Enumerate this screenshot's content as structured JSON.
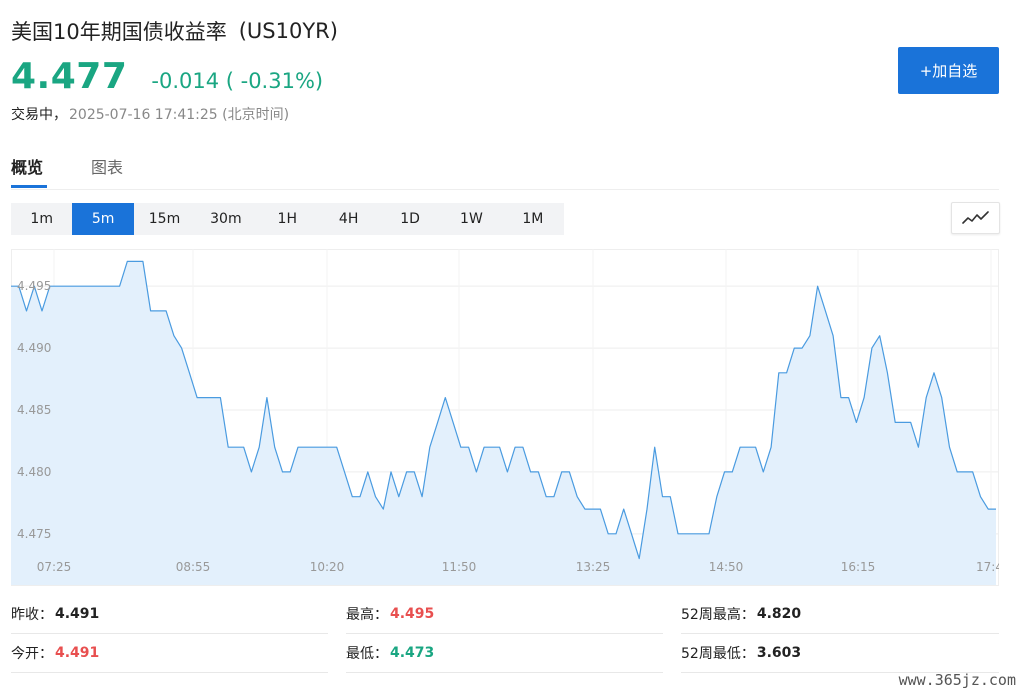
{
  "header": {
    "name": "美国10年期国债收益率",
    "code": "(US10YR)",
    "price": "4.477",
    "change": "-0.014 ( -0.31%)",
    "status_label": "交易中，",
    "status_time": "2025-07-16 17:41:25 (北京时间)",
    "add_button_label": "+加自选"
  },
  "tabs": [
    {
      "label": "概览",
      "active": true
    },
    {
      "label": "图表",
      "active": false
    }
  ],
  "periods": [
    {
      "label": "1m",
      "active": false
    },
    {
      "label": "5m",
      "active": true
    },
    {
      "label": "15m",
      "active": false
    },
    {
      "label": "30m",
      "active": false
    },
    {
      "label": "1H",
      "active": false
    },
    {
      "label": "4H",
      "active": false
    },
    {
      "label": "1D",
      "active": false
    },
    {
      "label": "1W",
      "active": false
    },
    {
      "label": "1M",
      "active": false
    }
  ],
  "chart_type_icon": "line-chart-icon",
  "colors": {
    "accent": "#1a73d9",
    "down": "#1aa682",
    "up": "#e84f4f",
    "line": "#4a9be0",
    "fill": "#e3f0fc"
  },
  "chart_data": {
    "type": "area",
    "title": "",
    "xlabel": "",
    "ylabel": "",
    "ylim": [
      4.472,
      4.498
    ],
    "yticks": [
      "4.475",
      "4.480",
      "4.485",
      "4.490",
      "4.495"
    ],
    "xtick_labels": [
      "07:25",
      "08:55",
      "10:20",
      "11:50",
      "13:25",
      "14:50",
      "16:15",
      "17:4"
    ],
    "grid": true,
    "values": [
      4.495,
      4.495,
      4.493,
      4.495,
      4.493,
      4.495,
      4.495,
      4.495,
      4.495,
      4.495,
      4.495,
      4.495,
      4.495,
      4.495,
      4.495,
      4.497,
      4.497,
      4.497,
      4.493,
      4.493,
      4.493,
      4.491,
      4.49,
      4.488,
      4.486,
      4.486,
      4.486,
      4.486,
      4.482,
      4.482,
      4.482,
      4.48,
      4.482,
      4.486,
      4.482,
      4.48,
      4.48,
      4.482,
      4.482,
      4.482,
      4.482,
      4.482,
      4.482,
      4.48,
      4.478,
      4.478,
      4.48,
      4.478,
      4.477,
      4.48,
      4.478,
      4.48,
      4.48,
      4.478,
      4.482,
      4.484,
      4.486,
      4.484,
      4.482,
      4.482,
      4.48,
      4.482,
      4.482,
      4.482,
      4.48,
      4.482,
      4.482,
      4.48,
      4.48,
      4.478,
      4.478,
      4.48,
      4.48,
      4.478,
      4.477,
      4.477,
      4.477,
      4.475,
      4.475,
      4.477,
      4.475,
      4.473,
      4.477,
      4.482,
      4.478,
      4.478,
      4.475,
      4.475,
      4.475,
      4.475,
      4.475,
      4.478,
      4.48,
      4.48,
      4.482,
      4.482,
      4.482,
      4.48,
      4.482,
      4.488,
      4.488,
      4.49,
      4.49,
      4.491,
      4.495,
      4.493,
      4.491,
      4.486,
      4.486,
      4.484,
      4.486,
      4.49,
      4.491,
      4.488,
      4.484,
      4.484,
      4.484,
      4.482,
      4.486,
      4.488,
      4.486,
      4.482,
      4.48,
      4.48,
      4.48,
      4.478,
      4.477,
      4.477
    ]
  },
  "stats": [
    [
      {
        "label": "昨收：",
        "value": "4.491",
        "tone": "neutral"
      },
      {
        "label": "最高：",
        "value": "4.495",
        "tone": "up"
      },
      {
        "label": "52周最高：",
        "value": "4.820",
        "tone": "neutral"
      }
    ],
    [
      {
        "label": "今开：",
        "value": "4.491",
        "tone": "up"
      },
      {
        "label": "最低：",
        "value": "4.473",
        "tone": "down"
      },
      {
        "label": "52周最低：",
        "value": "3.603",
        "tone": "neutral"
      }
    ]
  ],
  "watermark": "www.365jz.com"
}
